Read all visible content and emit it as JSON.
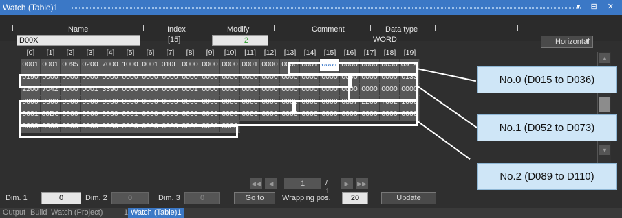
{
  "window": {
    "title": "Watch (Table)1",
    "buttons": "▾ ⊟ ✕"
  },
  "columns": {
    "name": "Name",
    "index": "Index",
    "modify": "Modify",
    "comment": "Comment",
    "data_type": "Data type"
  },
  "entry": {
    "name": "D00X",
    "index": "[15]",
    "modify": "2",
    "comment": "",
    "data_type": "WORD"
  },
  "orientation": "Horizontal",
  "index_headers": [
    "[0]",
    "[1]",
    "[2]",
    "[3]",
    "[4]",
    "[5]",
    "[6]",
    "[7]",
    "[8]",
    "[9]",
    "[10]",
    "[11]",
    "[12]",
    "[13]",
    "[14]",
    "[15]",
    "[16]",
    "[17]",
    "[18]",
    "[19]"
  ],
  "rows": [
    [
      "0001",
      "0001",
      "0095",
      "0200",
      "7000",
      "1000",
      "0001",
      "010E",
      "0000",
      "0000",
      "0000",
      "0001",
      "0000",
      "0000",
      "0001",
      "0001",
      "0000",
      "0000",
      "0050",
      "091A"
    ],
    [
      "0190",
      "0000",
      "0000",
      "0000",
      "0000",
      "0000",
      "0000",
      "0000",
      "0000",
      "0000",
      "0000",
      "0000",
      "0000",
      "0000",
      "0000",
      "0000",
      "0000",
      "0000",
      "0000",
      "0133"
    ],
    [
      "2200",
      "7042",
      "1000",
      "0001",
      "3390",
      "0000",
      "0000",
      "0000",
      "0001",
      "0000",
      "0000",
      "0000",
      "0000",
      "0000",
      "0000",
      "0000",
      "0000",
      "0000",
      "0000",
      "0000"
    ],
    [
      "0000",
      "0000",
      "0000",
      "0000",
      "0000",
      "0000",
      "0000",
      "0000",
      "0000",
      "0000",
      "0000",
      "0000",
      "0000",
      "0000",
      "0000",
      "0000",
      "0887",
      "2200",
      "7002",
      "1000"
    ],
    [
      "0001",
      "00D8",
      "0000",
      "0000",
      "0000",
      "0001",
      "0000",
      "0000",
      "0000",
      "0000",
      "0000",
      "0000",
      "0000",
      "0000",
      "0000",
      "0000",
      "0000",
      "0000",
      "0000",
      "0000"
    ],
    [
      "0000",
      "0000",
      "0000",
      "0000",
      "0000",
      "0000",
      "0000",
      "0000",
      "0000",
      "0000",
      "0000"
    ]
  ],
  "selected_cell": {
    "row": 0,
    "col": 15
  },
  "callouts": [
    "No.0 (D015 to D036)",
    "No.1 (D052 to D073)",
    "No.2 (D089 to D110)"
  ],
  "pager": {
    "current": "1",
    "total": "/ 1"
  },
  "bottom": {
    "dim1_label": "Dim. 1",
    "dim1_value": "0",
    "dim2_label": "Dim. 2",
    "dim2_value": "0",
    "dim3_label": "Dim. 3",
    "dim3_value": "0",
    "goto_label": "Go to",
    "wrap_label": "Wrapping pos.",
    "wrap_value": "20",
    "update_label": "Update"
  },
  "tabs": [
    {
      "label": "Output",
      "active": false
    },
    {
      "label": "Build",
      "active": false
    },
    {
      "label": "Watch (Project)",
      "active": false
    },
    {
      "label": "1",
      "active": false
    },
    {
      "label": "Watch (Table)1",
      "active": true
    }
  ],
  "colors": {
    "title_bar": "#3b78c6",
    "callout_bg": "#cfe6f7",
    "selected_text": "#2a6cc4",
    "modify_text": "#2e9b2e"
  }
}
